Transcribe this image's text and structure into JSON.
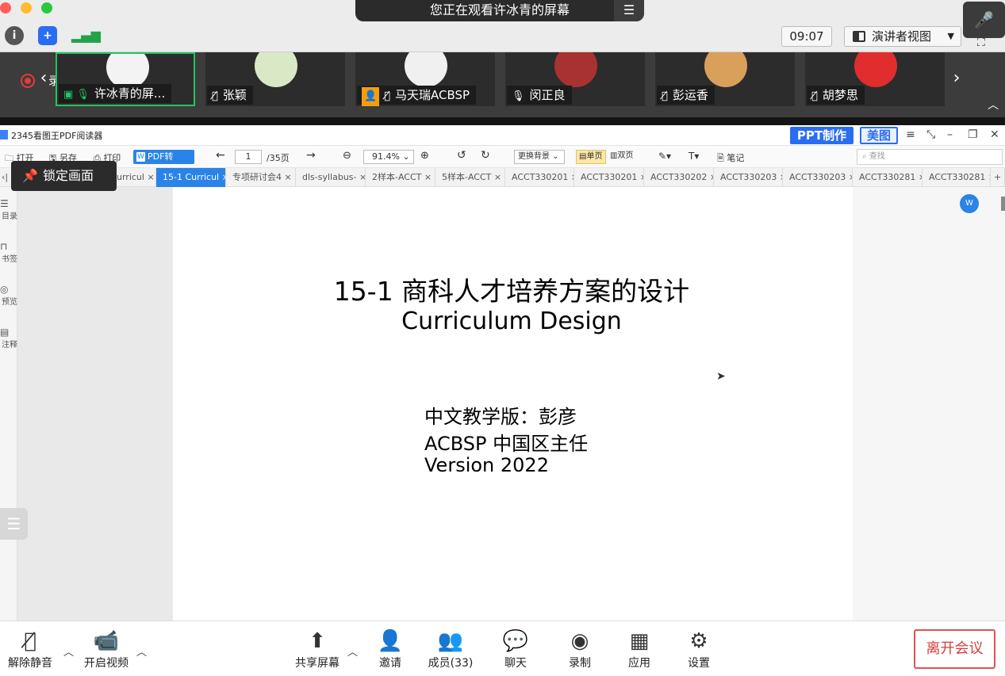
{
  "meeting": {
    "banner_text": "您正在观看许冰青的屏幕",
    "clock": "09:07",
    "view_button_label": "演讲者视图",
    "recording_label": "录制中"
  },
  "participants": [
    {
      "name": "许冰青的屏...",
      "muted": false
    },
    {
      "name": "张颖",
      "muted": true
    },
    {
      "name": "马天瑞ACBSP",
      "muted": true
    },
    {
      "name": "闵正良",
      "muted": false
    },
    {
      "name": "彭运香",
      "muted": true
    },
    {
      "name": "胡梦思",
      "muted": true
    }
  ],
  "pdf": {
    "app_title": "2345看图王PDF阅读器",
    "ppt_button": "PPT制作",
    "meitu_button": "美图",
    "toolbar": {
      "open": "打开",
      "saveas": "另存",
      "print": "打印",
      "pdf_to_word": "PDF转Word",
      "page_current": "1",
      "page_total": "/35页",
      "zoom": "91.4%",
      "background": "更换背景",
      "single": "单页",
      "double": "双页",
      "notes": "笔记",
      "search_placeholder": "查找"
    },
    "tabs": [
      "urricul",
      "15-1 Curricul",
      "专项研讨会4",
      "dls-syllabus-",
      "2样本-ACCT",
      "5样本-ACCT",
      "ACCT330201",
      "ACCT330201",
      "ACCT330202",
      "ACCT330203",
      "ACCT330203",
      "ACCT330281",
      "ACCT330281"
    ],
    "active_tab_index": 1,
    "sidebar": [
      "目录",
      "书签",
      "预览",
      "注释"
    ],
    "lock_button": "锁定画面",
    "slide": {
      "title": "15-1 商科人才培养方案的设计",
      "subtitle": "Curriculum Design",
      "line1": "中文教学版：彭彦",
      "line2": "ACBSP 中国区主任",
      "line3": "Version 2022"
    }
  },
  "controls": {
    "unmute": "解除静音",
    "start_video": "开启视频",
    "share_screen": "共享屏幕",
    "invite": "邀请",
    "members": "成员(33)",
    "chat": "聊天",
    "record": "录制",
    "apps": "应用",
    "settings": "设置",
    "leave": "离开会议"
  },
  "colors": {
    "accent": "#2a84e8",
    "active_speaker": "#22c55e",
    "leave": "#d93b3b"
  }
}
